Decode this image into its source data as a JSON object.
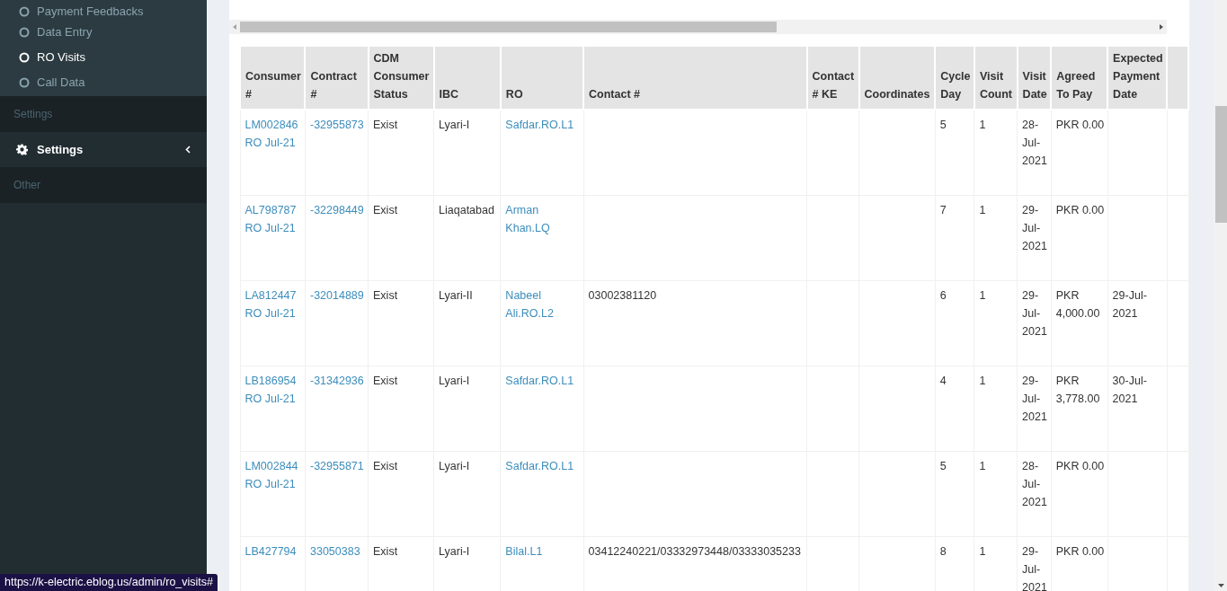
{
  "sidebar": {
    "entries": [
      {
        "kind": "subitem",
        "label": "Payment Feedbacks",
        "selected": false
      },
      {
        "kind": "subitem",
        "label": "Data Entry",
        "selected": false
      },
      {
        "kind": "subitem",
        "label": "RO Visits",
        "selected": true
      },
      {
        "kind": "subitem",
        "label": "Call Data",
        "selected": false
      },
      {
        "kind": "header",
        "label": "Settings"
      },
      {
        "kind": "menu",
        "label": "Settings",
        "selected": false
      },
      {
        "kind": "header",
        "label": "Other"
      }
    ]
  },
  "table": {
    "columns": [
      "Consumer #",
      "Contract #",
      "CDM Consumer Status",
      "IBC",
      "RO",
      "Contact #",
      "Contact # KE",
      "Coordinates",
      "Cycle Day",
      "Visit Count",
      "Visit Date",
      "Agreed To Pay",
      "Expected Payment Date"
    ],
    "rows": [
      {
        "cells": [
          {
            "text": "LM002846 RO Jul-21",
            "link": true
          },
          {
            "text": "-32955873",
            "link": true
          },
          {
            "text": "Exist",
            "link": false
          },
          {
            "text": "Lyari-I",
            "link": false
          },
          {
            "text": "Safdar.RO.L1",
            "link": true
          },
          null,
          null,
          null,
          {
            "text": "5",
            "link": false
          },
          {
            "text": "1",
            "link": false
          },
          {
            "text": "28-Jul-2021",
            "link": false
          },
          {
            "text": "PKR 0.00",
            "link": false
          },
          null
        ]
      },
      {
        "cells": [
          {
            "text": "AL798787 RO Jul-21",
            "link": true
          },
          {
            "text": "-32298449",
            "link": true
          },
          {
            "text": "Exist",
            "link": false
          },
          {
            "text": "Liaqatabad",
            "link": false
          },
          {
            "text": "Arman Khan.LQ",
            "link": true
          },
          null,
          null,
          null,
          {
            "text": "7",
            "link": false
          },
          {
            "text": "1",
            "link": false
          },
          {
            "text": "29-Jul-2021",
            "link": false
          },
          {
            "text": "PKR 0.00",
            "link": false
          },
          null
        ]
      },
      {
        "cells": [
          {
            "text": "LA812447 RO Jul-21",
            "link": true
          },
          {
            "text": "-32014889",
            "link": true
          },
          {
            "text": "Exist",
            "link": false
          },
          {
            "text": "Lyari-II",
            "link": false
          },
          {
            "text": "Nabeel Ali.RO.L2",
            "link": true
          },
          {
            "text": "03002381120",
            "link": false
          },
          null,
          null,
          {
            "text": "6",
            "link": false
          },
          {
            "text": "1",
            "link": false
          },
          {
            "text": "29-Jul-2021",
            "link": false
          },
          {
            "text": "PKR 4,000.00",
            "link": false
          },
          {
            "text": "29-Jul-2021",
            "link": false
          }
        ]
      },
      {
        "cells": [
          {
            "text": "LB186954 RO Jul-21",
            "link": true
          },
          {
            "text": "-31342936",
            "link": true
          },
          {
            "text": "Exist",
            "link": false
          },
          {
            "text": "Lyari-I",
            "link": false
          },
          {
            "text": "Safdar.RO.L1",
            "link": true
          },
          null,
          null,
          null,
          {
            "text": "4",
            "link": false
          },
          {
            "text": "1",
            "link": false
          },
          {
            "text": "29-Jul-2021",
            "link": false
          },
          {
            "text": "PKR 3,778.00",
            "link": false
          },
          {
            "text": "30-Jul-2021",
            "link": false
          }
        ]
      },
      {
        "cells": [
          {
            "text": "LM002844 RO Jul-21",
            "link": true
          },
          {
            "text": "-32955871",
            "link": true
          },
          {
            "text": "Exist",
            "link": false
          },
          {
            "text": "Lyari-I",
            "link": false
          },
          {
            "text": "Safdar.RO.L1",
            "link": true
          },
          null,
          null,
          null,
          {
            "text": "5",
            "link": false
          },
          {
            "text": "1",
            "link": false
          },
          {
            "text": "28-Jul-2021",
            "link": false
          },
          {
            "text": "PKR 0.00",
            "link": false
          },
          null
        ]
      },
      {
        "cells": [
          {
            "text": "LB427794",
            "link": true
          },
          {
            "text": "33050383",
            "link": true
          },
          {
            "text": "Exist",
            "link": false
          },
          {
            "text": "Lyari-I",
            "link": false
          },
          {
            "text": "Bilal.L1",
            "link": true
          },
          {
            "text": "03412240221/03332973448/03333035233",
            "link": false
          },
          null,
          null,
          {
            "text": "8",
            "link": false
          },
          {
            "text": "1",
            "link": false
          },
          {
            "text": "29-Jul-2021",
            "link": false
          },
          {
            "text": "PKR 0.00",
            "link": false
          },
          null
        ]
      }
    ]
  },
  "status_bar": {
    "url": "https://k-electric.eblog.us/admin/ro_visits#"
  }
}
